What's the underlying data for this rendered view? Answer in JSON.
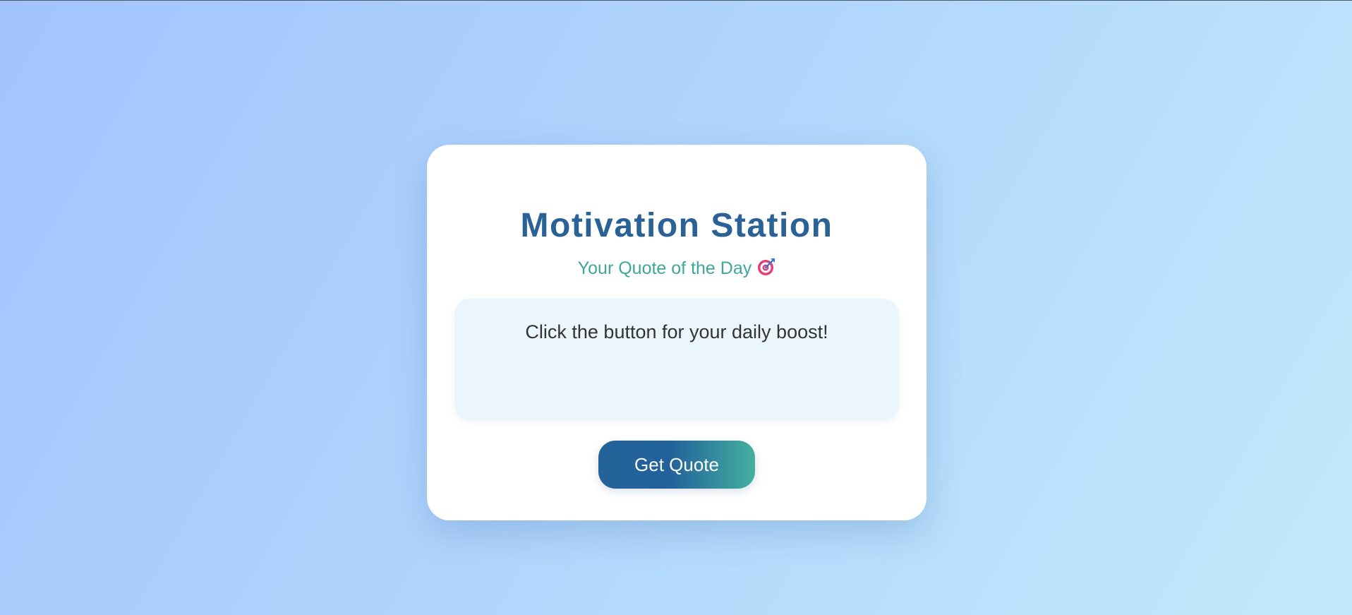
{
  "card": {
    "title": "Motivation Station",
    "subtitle": "Your Quote of the Day",
    "subtitle_icon": "target-icon",
    "quote_text": "Click the button for your daily boost!",
    "button_label": "Get Quote"
  },
  "colors": {
    "background_start": "#a1c4fd",
    "background_end": "#c2e9fb",
    "title": "#2a6297",
    "subtitle": "#3fa79a",
    "quote_box": "#eaf5fc",
    "button_start": "#24639a",
    "button_end": "#44afa0"
  }
}
